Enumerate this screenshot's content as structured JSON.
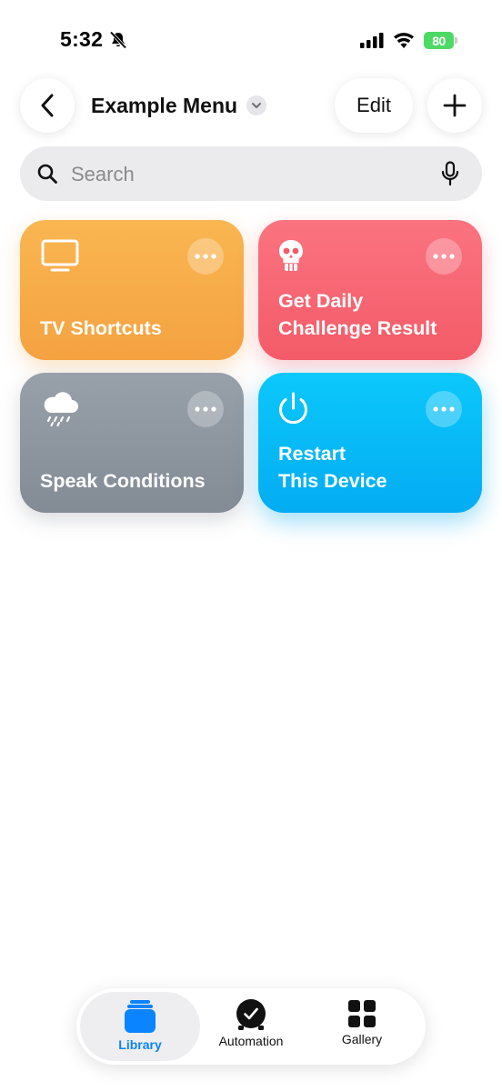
{
  "status_bar": {
    "time": "5:32",
    "battery": "80",
    "icons": [
      "bell-slash-icon",
      "cellular-signal-icon",
      "wifi-icon",
      "battery-charging-icon"
    ]
  },
  "nav": {
    "back_icon": "chevron-left-icon",
    "title": "Example Menu",
    "title_chevron_icon": "chevron-down-icon",
    "edit_label": "Edit",
    "add_icon": "plus-icon"
  },
  "search": {
    "placeholder": "Search",
    "value": "",
    "icons": [
      "magnifying-glass-icon",
      "microphone-icon"
    ]
  },
  "shortcuts": [
    {
      "label": "TV Shortcuts",
      "icon": "tv-icon",
      "color": "#f5a241"
    },
    {
      "label": "Get Daily\nChallenge Result",
      "icon": "skull-icon",
      "color": "#f45b68"
    },
    {
      "label": "Speak Conditions",
      "icon": "cloud-rain-icon",
      "color": "#838b95"
    },
    {
      "label": "Restart\nThis Device",
      "icon": "power-icon",
      "color": "#04acf2"
    }
  ],
  "more_icon": "ellipsis-icon",
  "tabbar": {
    "tabs": [
      {
        "label": "Library",
        "icon": "stacked-squares-icon",
        "selected": true
      },
      {
        "label": "Automation",
        "icon": "clock-icon",
        "selected": false
      },
      {
        "label": "Gallery",
        "icon": "grid-icon",
        "selected": false
      }
    ]
  },
  "colors": {
    "accent": "#0a84ff",
    "battery": "#4cd964"
  }
}
